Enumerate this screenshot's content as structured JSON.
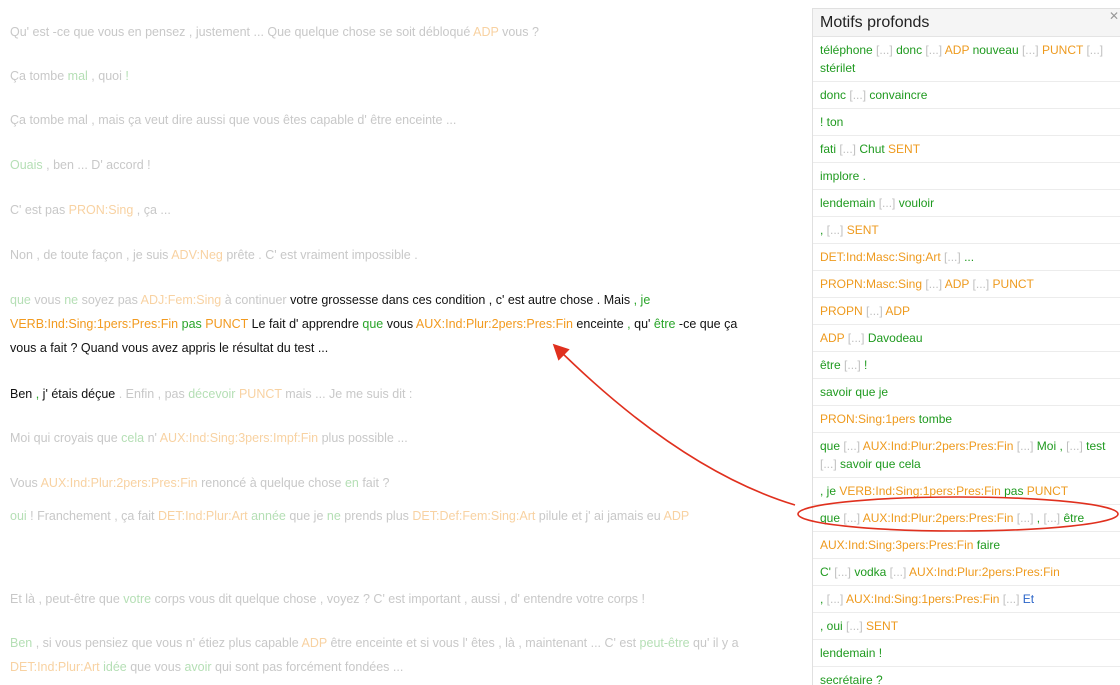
{
  "panel": {
    "title": "Motifs profonds",
    "close_icon": "close-icon",
    "patterns": [
      [
        [
          "téléphone",
          "g"
        ],
        [
          " [...] ",
          "x"
        ],
        [
          "donc",
          "g"
        ],
        [
          " [...] ",
          "x"
        ],
        [
          "ADP",
          "o"
        ],
        [
          " nouveau",
          "g"
        ],
        [
          " [...] ",
          "x"
        ],
        [
          "PUNCT",
          "o"
        ],
        [
          " [...] ",
          "x"
        ],
        [
          "stérilet",
          "g"
        ]
      ],
      [
        [
          "donc",
          "g"
        ],
        [
          " [...] ",
          "x"
        ],
        [
          "convaincre",
          "g"
        ]
      ],
      [
        [
          "! ton",
          "g"
        ]
      ],
      [
        [
          "fati",
          "g"
        ],
        [
          " [...] ",
          "x"
        ],
        [
          "Chut",
          "g"
        ],
        [
          " SENT",
          "o"
        ]
      ],
      [
        [
          "implore .",
          "g"
        ]
      ],
      [
        [
          "lendemain",
          "g"
        ],
        [
          " [...] ",
          "x"
        ],
        [
          "vouloir",
          "g"
        ]
      ],
      [
        [
          ",",
          "g"
        ],
        [
          " [...] ",
          "x"
        ],
        [
          "SENT",
          "o"
        ]
      ],
      [
        [
          "DET:Ind:Masc:Sing:Art",
          "o"
        ],
        [
          " [...] ",
          "x"
        ],
        [
          "...",
          "g"
        ]
      ],
      [
        [
          "PROPN:Masc:Sing",
          "o"
        ],
        [
          " [...] ",
          "x"
        ],
        [
          "ADP",
          "o"
        ],
        [
          " [...] ",
          "x"
        ],
        [
          "PUNCT",
          "o"
        ]
      ],
      [
        [
          "PROPN",
          "o"
        ],
        [
          " [...] ",
          "x"
        ],
        [
          "ADP",
          "o"
        ]
      ],
      [
        [
          "ADP",
          "o"
        ],
        [
          " [...] ",
          "x"
        ],
        [
          "Davodeau",
          "g"
        ]
      ],
      [
        [
          "être",
          "g"
        ],
        [
          " [...] ",
          "x"
        ],
        [
          "!",
          "g"
        ]
      ],
      [
        [
          "savoir que je",
          "g"
        ]
      ],
      [
        [
          "PRON:Sing:1pers",
          "o"
        ],
        [
          " tombe",
          "g"
        ]
      ],
      [
        [
          "que",
          "g"
        ],
        [
          " [...] ",
          "x"
        ],
        [
          "AUX:Ind:Plur:2pers:Pres:Fin",
          "o"
        ],
        [
          " [...] ",
          "x"
        ],
        [
          "Moi ,",
          "g"
        ],
        [
          " [...] ",
          "x"
        ],
        [
          "test",
          "g"
        ],
        [
          " [...] ",
          "x"
        ],
        [
          "savoir que cela",
          "g"
        ]
      ],
      [
        [
          ", je ",
          "g"
        ],
        [
          "VERB:Ind:Sing:1pers:Pres:Fin",
          "o"
        ],
        [
          " pas ",
          "g"
        ],
        [
          "PUNCT",
          "o"
        ]
      ],
      [
        [
          "que",
          "g"
        ],
        [
          " [...] ",
          "x"
        ],
        [
          "AUX:Ind:Plur:2pers:Pres:Fin",
          "o"
        ],
        [
          " [...] ",
          "x"
        ],
        [
          ",",
          "g"
        ],
        [
          " [...] ",
          "x"
        ],
        [
          "être",
          "g"
        ]
      ],
      [
        [
          "AUX:Ind:Sing:3pers:Pres:Fin",
          "o"
        ],
        [
          " faire",
          "g"
        ]
      ],
      [
        [
          "C'",
          "g"
        ],
        [
          " [...] ",
          "x"
        ],
        [
          "vodka",
          "g"
        ],
        [
          " [...] ",
          "x"
        ],
        [
          "AUX:Ind:Plur:2pers:Pres:Fin",
          "o"
        ]
      ],
      [
        [
          ",",
          "g"
        ],
        [
          " [...] ",
          "x"
        ],
        [
          "AUX:Ind:Sing:1pers:Pres:Fin",
          "o"
        ],
        [
          " [...] ",
          "x"
        ],
        [
          "Et",
          "b"
        ]
      ],
      [
        [
          ", oui",
          "g"
        ],
        [
          " [...] ",
          "x"
        ],
        [
          "SENT",
          "o"
        ]
      ],
      [
        [
          "lendemain !",
          "g"
        ]
      ],
      [
        [
          "secrétaire ?",
          "g"
        ]
      ]
    ]
  },
  "transcript": [
    [
      [
        "Qu' est -ce que vous en pensez , justement ... Que quelque chose se soit débloqué ",
        "dim"
      ],
      [
        "ADP",
        "dim-o"
      ],
      [
        " vous ?",
        "dim"
      ]
    ],
    [
      [
        "Ça tombe ",
        "dim"
      ],
      [
        "mal",
        "dim-g"
      ],
      [
        " , quoi ",
        "dim"
      ],
      [
        "!",
        "dim-g"
      ]
    ],
    [
      [
        "Ça tombe mal , mais ça veut dire aussi que vous êtes capable d' être enceinte ...",
        "dim"
      ]
    ],
    [
      [
        "Ouais",
        "dim-g"
      ],
      [
        " , ben ... D' accord !",
        "dim"
      ]
    ],
    [
      [
        "C' est pas ",
        "dim"
      ],
      [
        "PRON:Sing",
        "dim-o"
      ],
      [
        " , ça ...",
        "dim"
      ]
    ],
    [
      [
        "Non , de toute façon , je suis ",
        "dim"
      ],
      [
        "ADV:Neg",
        "dim-o"
      ],
      [
        " prête . C' est vraiment impossible .",
        "dim"
      ]
    ],
    [
      [
        "que",
        "dim-g"
      ],
      [
        " vous ",
        "dim"
      ],
      [
        "ne",
        "dim-g"
      ],
      [
        " soyez pas ",
        "dim"
      ],
      [
        "ADJ:Fem:Sing",
        "dim-o"
      ],
      [
        " à continuer ",
        "dim"
      ],
      [
        "votre grossesse dans ces condition , c' est autre chose . Mais ",
        "hl"
      ],
      [
        ", je",
        "hl-g"
      ],
      [
        " ",
        "hl"
      ],
      [
        "VERB:Ind:Sing:1pers:Pres:Fin",
        "hl-o"
      ],
      [
        " ",
        "hl"
      ],
      [
        "pas",
        "hl-g"
      ],
      [
        " ",
        "hl"
      ],
      [
        "PUNCT",
        "hl-o"
      ],
      [
        " Le fait d' apprendre ",
        "hl"
      ],
      [
        "que",
        "hl-g"
      ],
      [
        " vous ",
        "hl"
      ],
      [
        "AUX:Ind:Plur:2pers:Pres:Fin",
        "hl-o"
      ],
      [
        " enceinte ",
        "hl"
      ],
      [
        ",",
        "hl-g"
      ],
      [
        " qu' ",
        "hl"
      ],
      [
        "être",
        "hl-g"
      ],
      [
        " -ce que ça vous a fait ? Quand vous avez appris le résultat du test ...",
        "hl"
      ]
    ],
    [
      [
        "Ben ",
        "hl"
      ],
      [
        ",",
        "hl-g"
      ],
      [
        " j' étais déçue ",
        "hl"
      ],
      [
        ". Enfin , pas ",
        "dim"
      ],
      [
        "décevoir",
        "dim-g"
      ],
      [
        " ",
        "dim"
      ],
      [
        "PUNCT",
        "dim-o"
      ],
      [
        " mais ... Je me suis dit :",
        "dim"
      ]
    ],
    [
      [
        "Moi qui croyais que ",
        "dim"
      ],
      [
        "cela",
        "dim-g"
      ],
      [
        " n' ",
        "dim"
      ],
      [
        "AUX:Ind:Sing:3pers:Impf:Fin",
        "dim-o"
      ],
      [
        " plus possible ...",
        "dim"
      ]
    ],
    [
      [
        "Vous ",
        "dim"
      ],
      [
        "AUX:Ind:Plur:2pers:Pres:Fin",
        "dim-o"
      ],
      [
        " renoncé à quelque chose ",
        "dim"
      ],
      [
        "en",
        "dim-g"
      ],
      [
        " fait ?",
        "dim"
      ]
    ],
    [
      [
        "oui",
        "dim-g"
      ],
      [
        " ! Franchement , ça fait ",
        "dim"
      ],
      [
        "DET:Ind:Plur:Art",
        "dim-o"
      ],
      [
        " ",
        "dim"
      ],
      [
        "année",
        "dim-g"
      ],
      [
        " que je ",
        "dim"
      ],
      [
        "ne",
        "dim-g"
      ],
      [
        " prends plus ",
        "dim"
      ],
      [
        "DET:Def:Fem:Sing:Art",
        "dim-o"
      ],
      [
        " pilule et j' ai jamais eu ",
        "dim"
      ],
      [
        "ADP",
        "dim-o"
      ]
    ],
    [
      [
        "Et là , peut-être que ",
        "dim"
      ],
      [
        "votre",
        "dim-g"
      ],
      [
        " corps vous dit quelque chose , voyez ? C' est important , aussi , d' entendre votre corps !",
        "dim"
      ]
    ],
    [
      [
        "Ben",
        "dim-g"
      ],
      [
        " , si vous pensiez que vous n' étiez plus capable ",
        "dim"
      ],
      [
        "ADP",
        "dim-o"
      ],
      [
        " être enceinte et si vous l' êtes , là , maintenant ... C' est ",
        "dim"
      ],
      [
        "peut-être",
        "dim-g"
      ],
      [
        " qu' il y a ",
        "dim"
      ],
      [
        "DET:Ind:Plur:Art",
        "dim-o"
      ],
      [
        " ",
        "dim"
      ],
      [
        "idée",
        "dim-g"
      ],
      [
        " que vous ",
        "dim"
      ],
      [
        "avoir",
        "dim-g"
      ],
      [
        " qui sont pas forcément fondées ...",
        "dim"
      ]
    ]
  ],
  "annotation": {
    "arrow_color": "#e0301e",
    "ellipse_color": "#e0301e"
  }
}
